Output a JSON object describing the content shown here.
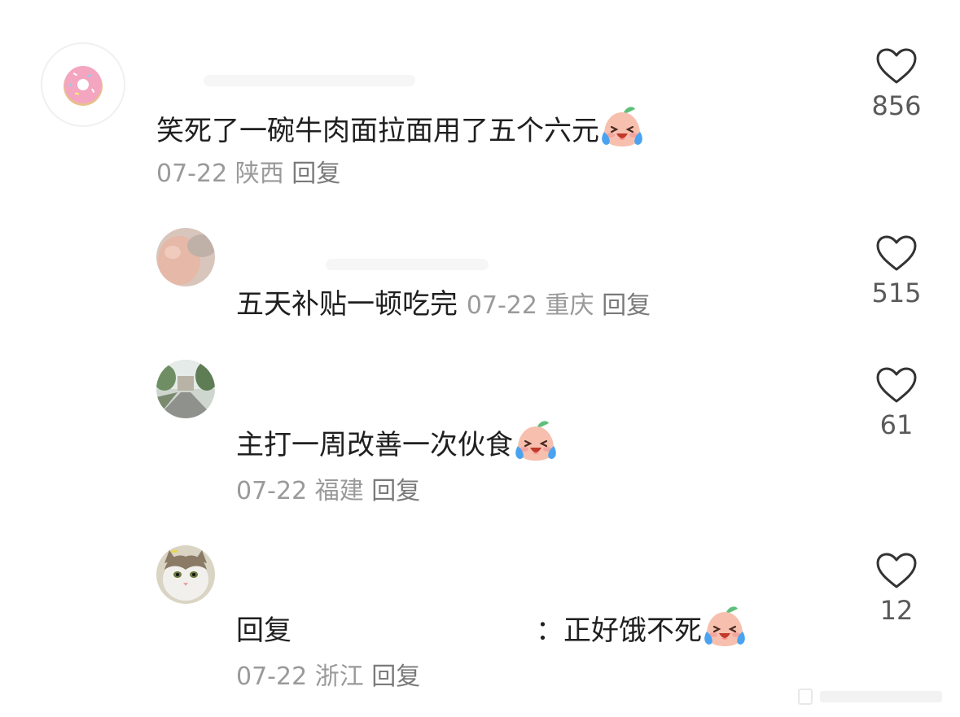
{
  "comments": [
    {
      "text": "笑死了一碗牛肉面拉面用了五个六元",
      "date": "07-22",
      "location": "陕西",
      "reply_label": "回复",
      "likes": "856",
      "emoji": "laugh-cry-emoji",
      "avatar": "donut-avatar"
    },
    {
      "text": "五天补贴一顿吃完",
      "date": "07-22",
      "location": "重庆",
      "reply_label": "回复",
      "likes": "515",
      "avatar": "photo-avatar"
    },
    {
      "text": "主打一周改善一次伙食",
      "date": "07-22",
      "location": "福建",
      "reply_label": "回复",
      "likes": "61",
      "emoji": "laugh-cry-emoji",
      "avatar": "street-avatar"
    },
    {
      "reply_prefix": "回复",
      "text": "：正好饿不死",
      "date": "07-22",
      "location": "浙江",
      "reply_label": "回复",
      "likes": "12",
      "emoji": "laugh-cry-emoji",
      "avatar": "cat-avatar"
    }
  ],
  "icons": {
    "like": "heart-outline-icon"
  },
  "colors": {
    "text": "#1f1f1f",
    "meta": "#9a9a9a",
    "heart_stroke": "#333333"
  }
}
